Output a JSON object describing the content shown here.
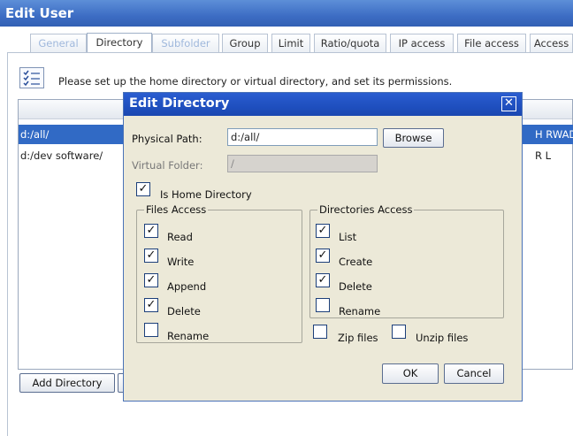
{
  "window": {
    "title": "Edit User"
  },
  "tabs": [
    {
      "label": "General"
    },
    {
      "label": "Directory"
    },
    {
      "label": "Subfolder"
    },
    {
      "label": "Group"
    },
    {
      "label": "Limit"
    },
    {
      "label": "Ratio/quota"
    },
    {
      "label": "IP access"
    },
    {
      "label": "File access"
    },
    {
      "label": "Access"
    }
  ],
  "info": {
    "text": "Please set up the home directory or virtual directory, and set its permissions."
  },
  "list": {
    "rows": [
      {
        "path": "d:/all/",
        "perm": "H RWAD LI",
        "selected": true
      },
      {
        "path": "d:/dev software/",
        "perm": "R L",
        "selected": false
      }
    ]
  },
  "buttons": {
    "add_directory": "Add Directory"
  },
  "dialog": {
    "title": "Edit Directory",
    "close_glyph": "✕",
    "physical_path_label": "Physical Path:",
    "physical_path_value": "d:/all/",
    "browse_label": "Browse",
    "virtual_folder_label": "Virtual Folder:",
    "virtual_folder_value": "/",
    "home_dir_label": "Is Home Directory",
    "files_access": {
      "legend": "Files Access",
      "items": [
        {
          "label": "Read",
          "checked": true
        },
        {
          "label": "Write",
          "checked": true
        },
        {
          "label": "Append",
          "checked": true
        },
        {
          "label": "Delete",
          "checked": true
        },
        {
          "label": "Rename",
          "checked": false
        }
      ]
    },
    "dirs_access": {
      "legend": "Directories Access",
      "items": [
        {
          "label": "List",
          "checked": true
        },
        {
          "label": "Create",
          "checked": true
        },
        {
          "label": "Delete",
          "checked": true
        },
        {
          "label": "Rename",
          "checked": false
        }
      ]
    },
    "zip_label": "Zip files",
    "unzip_label": "Unzip files",
    "ok_label": "OK",
    "cancel_label": "Cancel",
    "check_glyph": "✓"
  }
}
